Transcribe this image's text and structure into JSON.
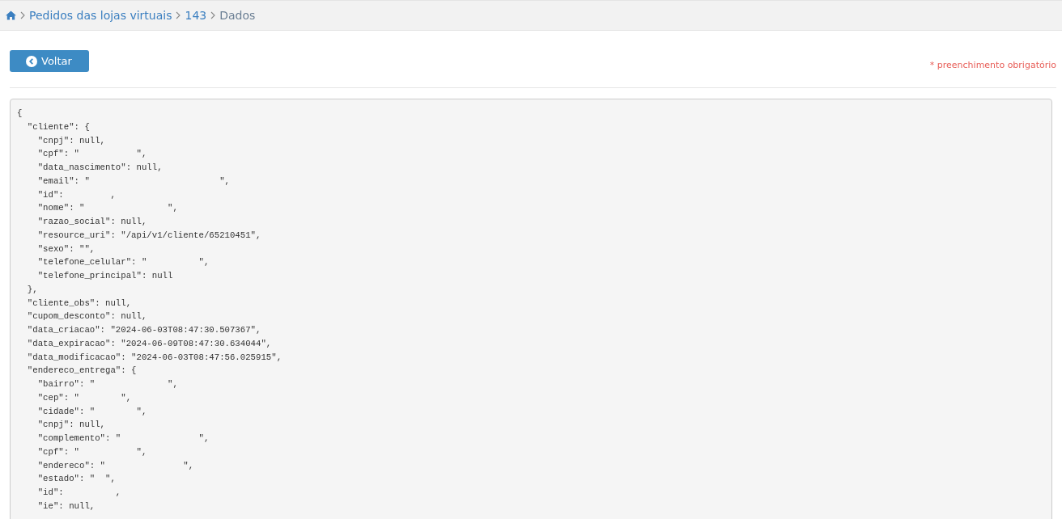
{
  "breadcrumb": {
    "items": [
      {
        "label": "Pedidos das lojas virtuais",
        "link": true
      },
      {
        "label": "143",
        "link": true
      },
      {
        "label": "Dados",
        "link": false
      }
    ]
  },
  "back_button": {
    "label": "Voltar"
  },
  "required_note": "* preenchimento obrigatório",
  "code_lines": [
    "{",
    "  \"cliente\": {",
    "    \"cnpj\": null,",
    "    \"cpf\": \"           \",",
    "    \"data_nascimento\": null,",
    "    \"email\": \"                         \",",
    "    \"id\":         ,",
    "    \"nome\": \"                \",",
    "    \"razao_social\": null,",
    "    \"resource_uri\": \"/api/v1/cliente/65210451\",",
    "    \"sexo\": \"\",",
    "    \"telefone_celular\": \"          \",",
    "    \"telefone_principal\": null",
    "  },",
    "  \"cliente_obs\": null,",
    "  \"cupom_desconto\": null,",
    "  \"data_criacao\": \"2024-06-03T08:47:30.507367\",",
    "  \"data_expiracao\": \"2024-06-09T08:47:30.634044\",",
    "  \"data_modificacao\": \"2024-06-03T08:47:56.025915\",",
    "  \"endereco_entrega\": {",
    "    \"bairro\": \"              \",",
    "    \"cep\": \"        \",",
    "    \"cidade\": \"        \",",
    "    \"cnpj\": null,",
    "    \"complemento\": \"               \",",
    "    \"cpf\": \"           \",",
    "    \"endereco\": \"               \",",
    "    \"estado\": \"  \",",
    "    \"id\":          ,",
    "    \"ie\": null,"
  ]
}
